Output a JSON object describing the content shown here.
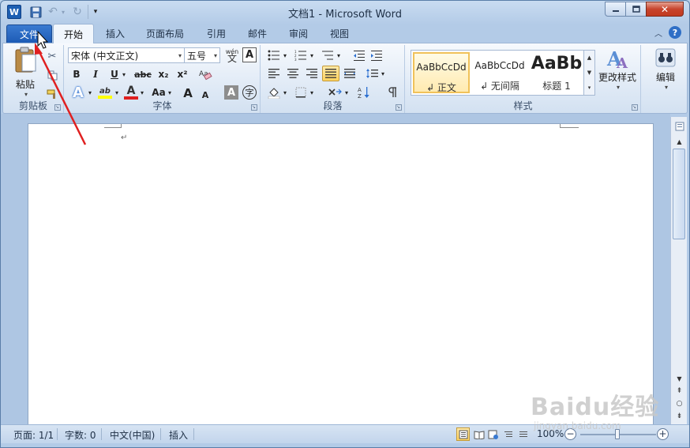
{
  "app": {
    "title": "文档1 - Microsoft Word",
    "word_icon": "W",
    "accent": "#1d5fb2"
  },
  "quick_access": {
    "icons": [
      "word-icon",
      "save-icon",
      "undo-icon",
      "redo-icon",
      "customize-dropdown"
    ]
  },
  "window_controls": {
    "close_label": "✕"
  },
  "tabs": {
    "file": "文件",
    "items": [
      "开始",
      "插入",
      "页面布局",
      "引用",
      "邮件",
      "审阅",
      "视图"
    ]
  },
  "ribbon": {
    "clipboard": {
      "label": "剪贴板",
      "paste": "粘贴"
    },
    "font": {
      "label": "字体",
      "font_name": "宋体 (中文正文)",
      "font_size": "五号",
      "wen_icon": "wén",
      "bold": "B",
      "italic": "I",
      "underline": "U",
      "strike": "abc",
      "subscript": "x₂",
      "superscript": "x²",
      "change_case": "Aa",
      "grow": "A",
      "shrink": "A",
      "char_shading": "A",
      "enclose": "字"
    },
    "paragraph": {
      "label": "段落"
    },
    "styles": {
      "label": "样式",
      "items": [
        {
          "preview": "AaBbCcDd",
          "name": "↲ 正文"
        },
        {
          "preview": "AaBbCcDd",
          "name": "↲ 无间隔"
        },
        {
          "preview": "AaBb",
          "name": "标题 1"
        }
      ],
      "change_styles": "更改样式"
    },
    "editing": {
      "label": "编辑"
    }
  },
  "document": {
    "paragraph_mark": "↵"
  },
  "status_bar": {
    "page": "页面: 1/1",
    "words": "字数: 0",
    "language": "中文(中国)",
    "mode": "插入",
    "zoom": "100%",
    "zoom_level": 1.0
  },
  "watermark": {
    "line1": "Baidu经验",
    "line2": "jingyan.baidu.com"
  }
}
